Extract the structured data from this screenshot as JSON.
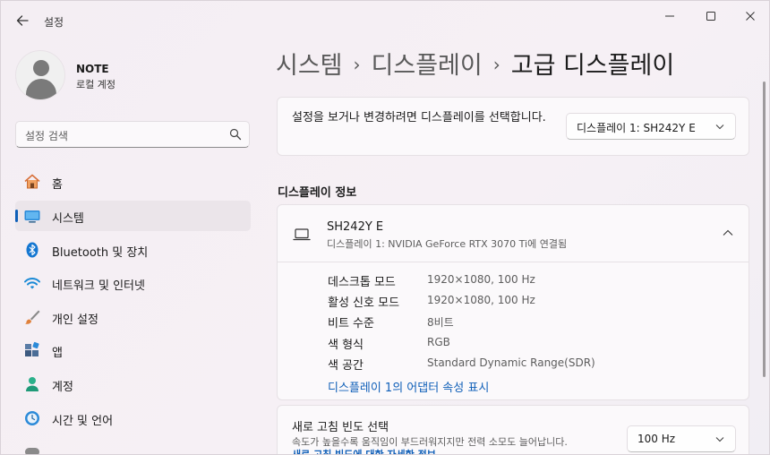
{
  "window": {
    "title": "설정",
    "controls": {
      "minimize": "minimize-icon",
      "maximize": "maximize-icon",
      "close": "close-icon"
    }
  },
  "profile": {
    "name": "NOTE",
    "subtitle": "로컬 계정"
  },
  "search": {
    "placeholder": "설정 검색"
  },
  "sidebar": {
    "items": [
      {
        "label": "홈",
        "icon": "home-icon"
      },
      {
        "label": "시스템",
        "icon": "system-icon",
        "active": true
      },
      {
        "label": "Bluetooth 및 장치",
        "icon": "bluetooth-icon"
      },
      {
        "label": "네트워크 및 인터넷",
        "icon": "wifi-icon"
      },
      {
        "label": "개인 설정",
        "icon": "brush-icon"
      },
      {
        "label": "앱",
        "icon": "apps-icon"
      },
      {
        "label": "계정",
        "icon": "account-icon"
      },
      {
        "label": "시간 및 언어",
        "icon": "clock-globe-icon"
      }
    ]
  },
  "breadcrumb": {
    "part1": "시스템",
    "part2": "디스플레이",
    "current": "고급 디스플레이",
    "separator": "›"
  },
  "display_select": {
    "prompt": "설정을 보거나 변경하려면 디스플레이를 선택합니다.",
    "selected": "디스플레이 1: SH242Y E"
  },
  "display_info": {
    "section_title": "디스플레이 정보",
    "monitor_name": "SH242Y E",
    "monitor_desc": "디스플레이 1: NVIDIA GeForce RTX 3070 Ti에 연결됨",
    "properties": [
      {
        "label": "데스크톱 모드",
        "value": "1920×1080, 100 Hz"
      },
      {
        "label": "활성 신호 모드",
        "value": "1920×1080, 100 Hz"
      },
      {
        "label": "비트 수준",
        "value": "8비트"
      },
      {
        "label": "색 형식",
        "value": "RGB"
      },
      {
        "label": "색 공간",
        "value": "Standard Dynamic Range(SDR)"
      }
    ],
    "adapter_link": "디스플레이 1의 어댑터 속성 표시"
  },
  "refresh_rate": {
    "title": "새로 고침 빈도 선택",
    "description": "속도가 높을수록 움직임이 부드러워지지만 전력 소모도 늘어납니다.",
    "link": "새로 고침 빈도에 대한 자세한 정보",
    "selected": "100 Hz"
  },
  "colors": {
    "accent": "#0f5fb8",
    "background": "#f4eef3",
    "card": "#fbf9fb"
  }
}
